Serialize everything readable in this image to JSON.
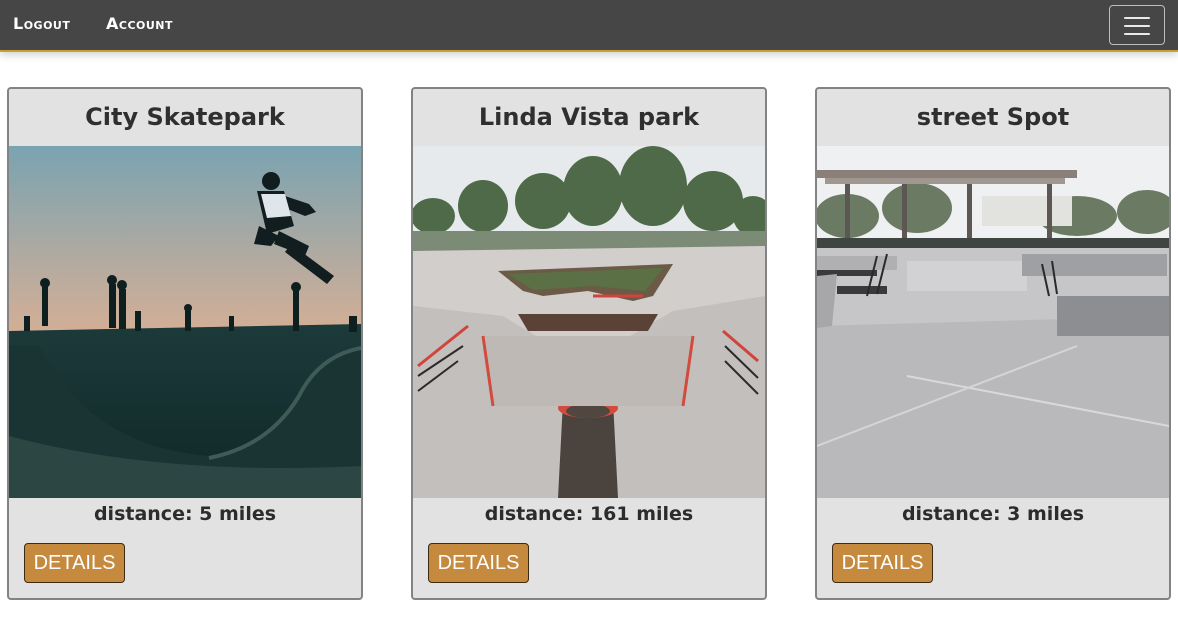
{
  "nav": {
    "logout_label": "Logout",
    "account_label": "Account",
    "menu_icon": "hamburger-menu-icon"
  },
  "colors": {
    "navbar_bg": "#464646",
    "navbar_accent": "#c8a032",
    "card_bg": "#e2e2e2",
    "button_bg": "#c58a3e"
  },
  "cards": [
    {
      "title": "City Skatepark",
      "distance": "distance: 5 miles",
      "button_label": "DETAILS"
    },
    {
      "title": "Linda Vista park",
      "distance": "distance: 161 miles",
      "button_label": "DETAILS"
    },
    {
      "title": "street Spot",
      "distance": "distance: 3 miles",
      "button_label": "DETAILS"
    }
  ]
}
